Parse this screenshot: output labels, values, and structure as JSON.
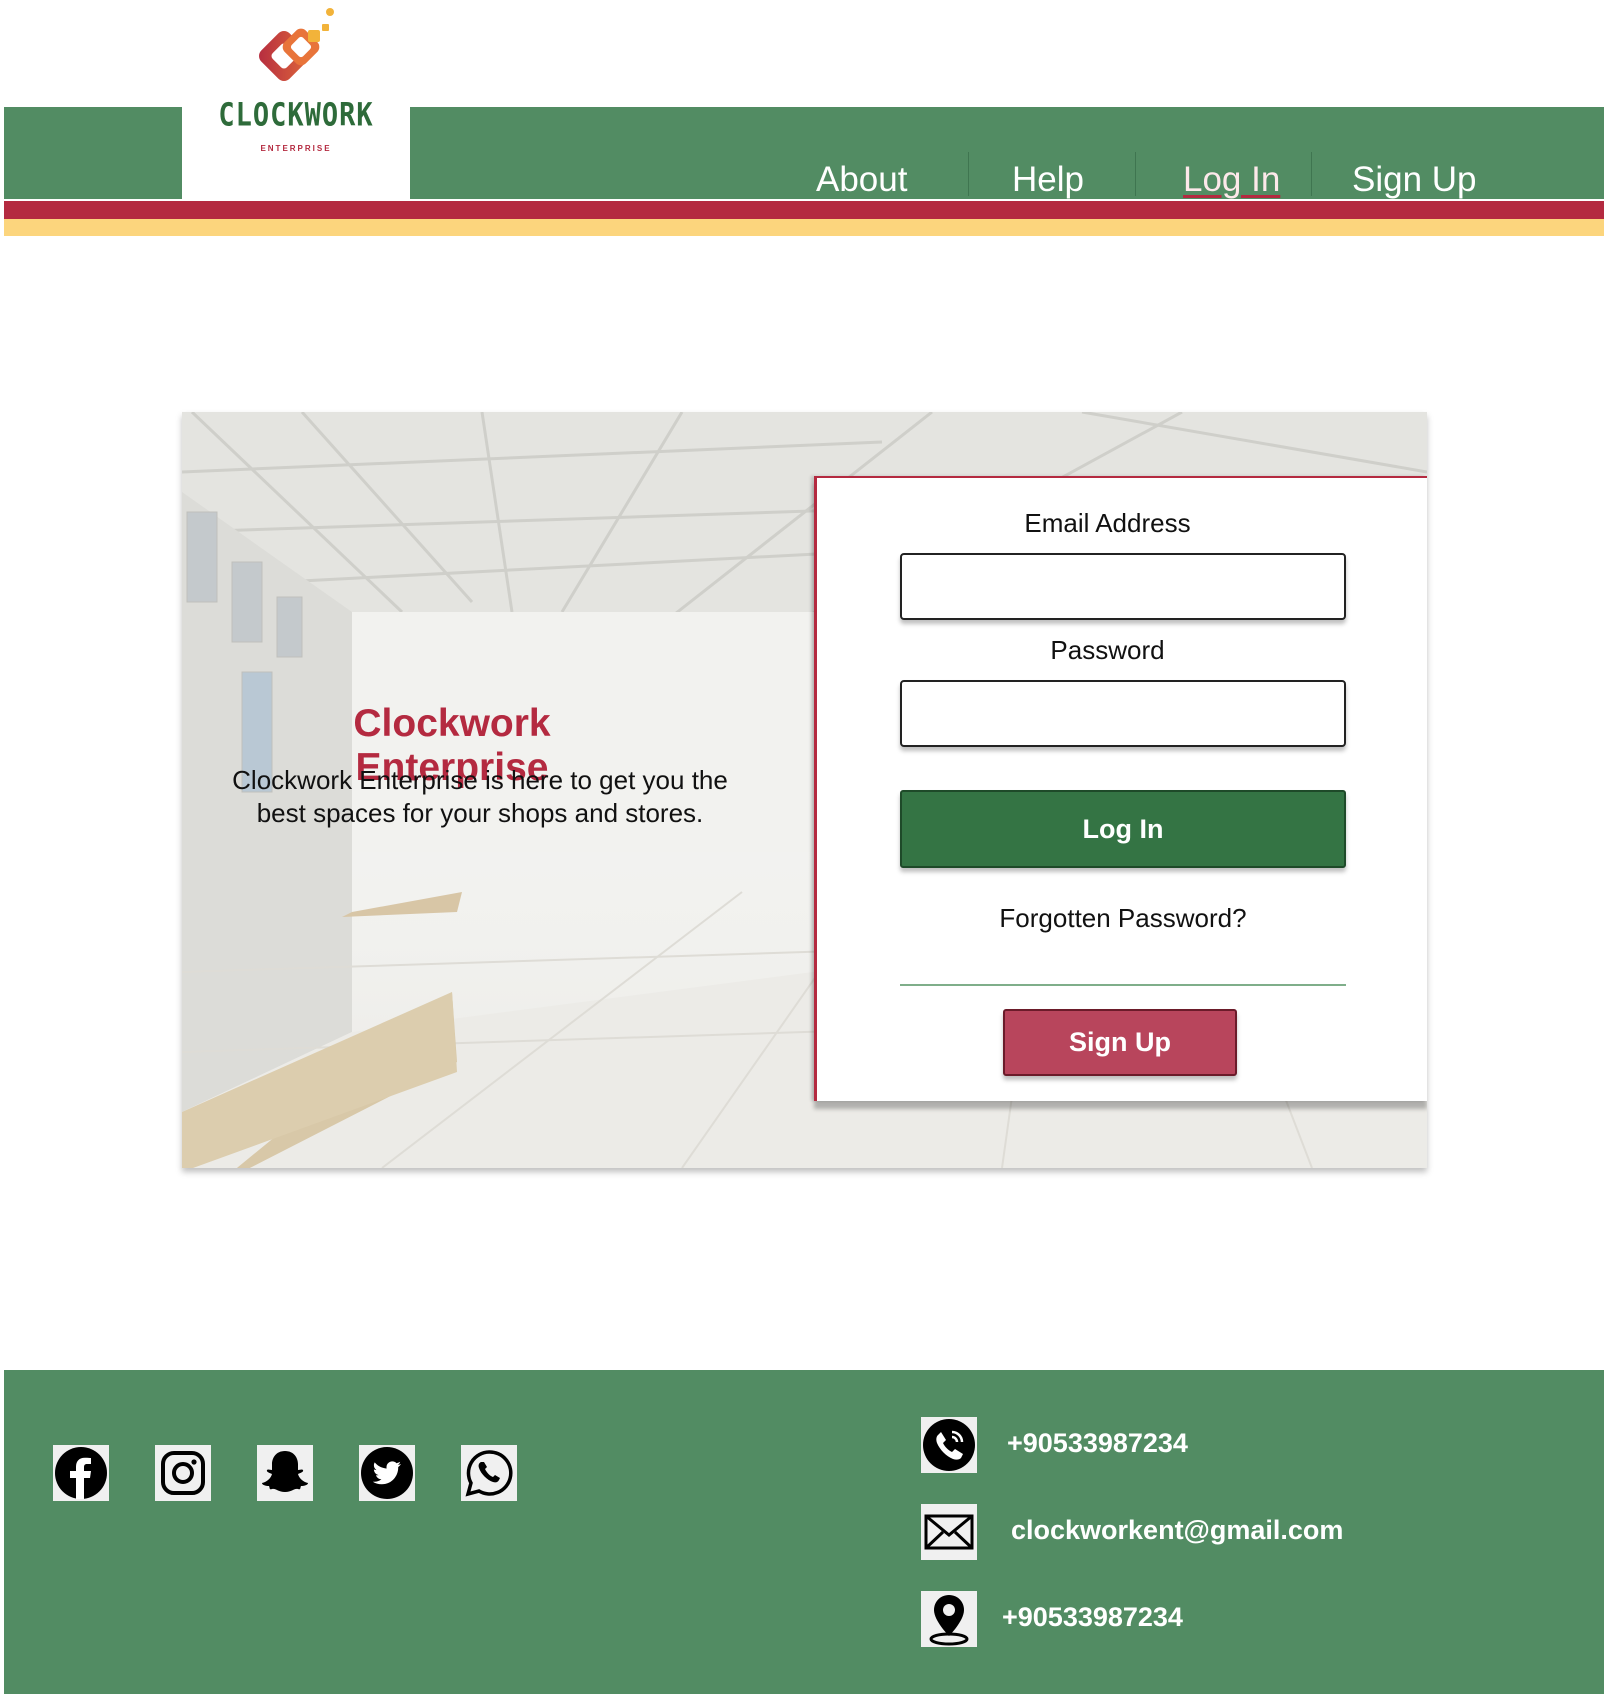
{
  "brand": {
    "name": "CLOCKWORK",
    "tagline": "ENTERPRISE"
  },
  "nav": {
    "items": [
      {
        "label": "About",
        "active": false
      },
      {
        "label": "Help",
        "active": false
      },
      {
        "label": "Log In",
        "active": true
      },
      {
        "label": "Sign Up",
        "active": false
      }
    ]
  },
  "hero": {
    "title": "Clockwork Enterprise",
    "description": "Clockwork Enterprise is here to get you the best spaces for your shops and stores."
  },
  "login": {
    "email_label": "Email Address",
    "email_value": "",
    "password_label": "Password",
    "password_value": "",
    "login_button": "Log In",
    "forgot_link": "Forgotten Password?",
    "signup_button": "Sign Up"
  },
  "footer": {
    "social": [
      {
        "name": "facebook-icon"
      },
      {
        "name": "instagram-icon"
      },
      {
        "name": "snapchat-icon"
      },
      {
        "name": "twitter-icon"
      },
      {
        "name": "whatsapp-icon"
      }
    ],
    "contacts": {
      "phone": "+90533987234",
      "email": "clockworkent@gmail.com",
      "location": "+90533987234"
    }
  },
  "colors": {
    "green": "#528c63",
    "dark_green": "#347444",
    "red": "#b42a40",
    "yellow": "#fcd57d",
    "signup": "#b8455c"
  }
}
